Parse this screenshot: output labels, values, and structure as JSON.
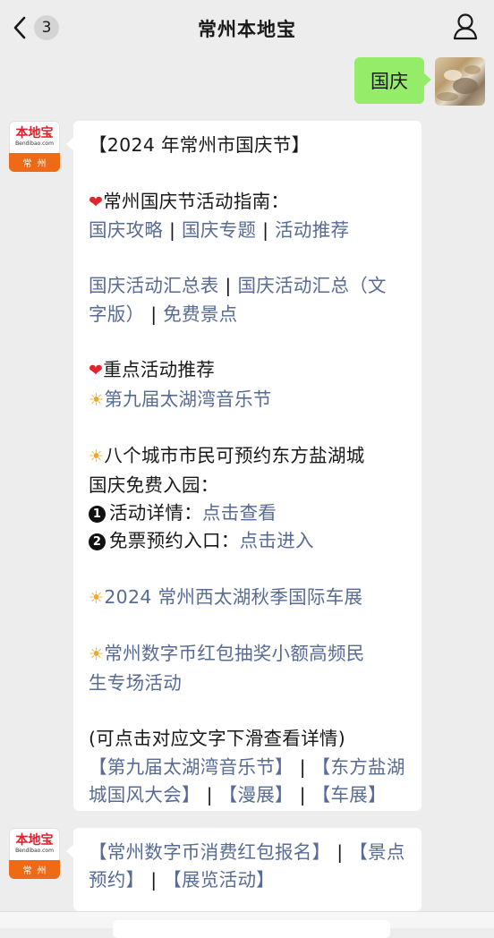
{
  "header": {
    "title": "常州本地宝",
    "unread_count": "3",
    "back_icon": "chevron-left-icon",
    "profile_icon": "person-icon"
  },
  "my_message": {
    "text": "国庆"
  },
  "sender": {
    "logo_text": "本地宝",
    "logo_sub": "Bendibao.com",
    "city": "常州"
  },
  "message1": {
    "title": "【2024 年常州市国庆节】",
    "guide_heading": "常州国庆节活动指南：",
    "guide_links_1": [
      "国庆攻略",
      "国庆专题",
      "活动推荐"
    ],
    "summary_line_1a": "国庆活动汇总表",
    "summary_line_1b": "国庆活动汇总（文",
    "summary_line_2a": "字版）",
    "summary_line_2b": "免费景点",
    "separator": " | ",
    "key_heading": "重点活动推荐",
    "festival": "第九届太湖湾音乐节",
    "yancheng_line1": "八个城市市民可预约东方盐湖城",
    "yancheng_line2": "国庆免费入园：",
    "detail_label": "活动详情：",
    "detail_link": "点击查看",
    "reserve_label": "免票预约入口：",
    "reserve_link": "点击进入",
    "num1": "1",
    "num2": "2",
    "carshow": "2024 常州西太湖秋季国际车展",
    "redpacket_line1": "常州数字币红包抽奖小额高频民",
    "redpacket_line2": "生专场活动",
    "hint": "(可点击对应文字下滑查看详情)",
    "bottom_line1a": "【第九届太湖湾音乐节】",
    "bottom_line1b": "【东方盐湖",
    "bottom_line2a": "城国风大会】",
    "bottom_line2b": "【漫展】",
    "bottom_line2c": "【车展】",
    "bar": " | "
  },
  "message2": {
    "line1a": "【常州数字币消费红包报名】",
    "line1b": "【景点",
    "line2a": "预约】",
    "line2b": "【展览活动】",
    "bar": " | "
  },
  "colors": {
    "link": "#576b95",
    "green_bubble": "#95ec69",
    "logo_orange": "#ee6a17",
    "logo_red": "#d9232f"
  }
}
